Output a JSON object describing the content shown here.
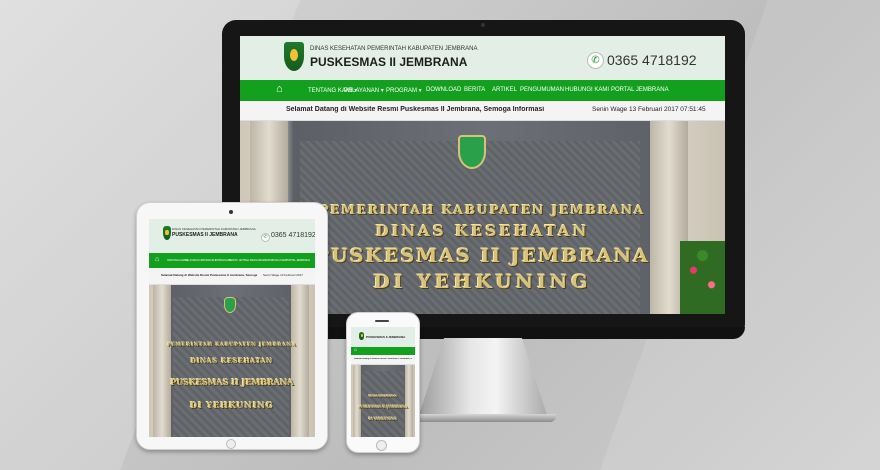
{
  "site": {
    "agency": "DINAS KESEHATAN PEMERINTAH KABUPATEN JEMBRANA",
    "name": "PUSKESMAS II JEMBRANA",
    "phone": "0365 4718192",
    "nav": [
      {
        "label": "TENTANG KAMI ▾"
      },
      {
        "label": "PELAYANAN ▾"
      },
      {
        "label": "PROGRAM ▾"
      },
      {
        "label": "DOWNLOAD"
      },
      {
        "label": "BERITA"
      },
      {
        "label": "ARTIKEL"
      },
      {
        "label": "PENGUMUMAN"
      },
      {
        "label": "HUBUNGI KAMI"
      },
      {
        "label": "PORTAL JEMBRANA"
      }
    ],
    "home_icon": "home-icon",
    "marquee": "Selamat Datang di Website Resmi Puskesmas II Jembrana, Semoga Informasi yang B",
    "tablet_marquee": "Selamat Datang di Website Resmi Puskesmas II Jembrana, Semoga Informasi yang B",
    "datetime": "Senin Wage 13 Februari 2017 07:51:45",
    "tablet_datetime": "Senin Wage 13 Februari 2017",
    "sign": {
      "line1": "PEMERINTAH KABUPATEN JEMBRANA",
      "line2": "DINAS KESEHATAN",
      "line3": "PUSKESMAS II JEMBRANA",
      "line4": "DI YEHKUNING"
    }
  },
  "colors": {
    "nav_green": "#14a01f",
    "header_bg": "#e3efe6",
    "text_gold": "#d8c27a"
  }
}
